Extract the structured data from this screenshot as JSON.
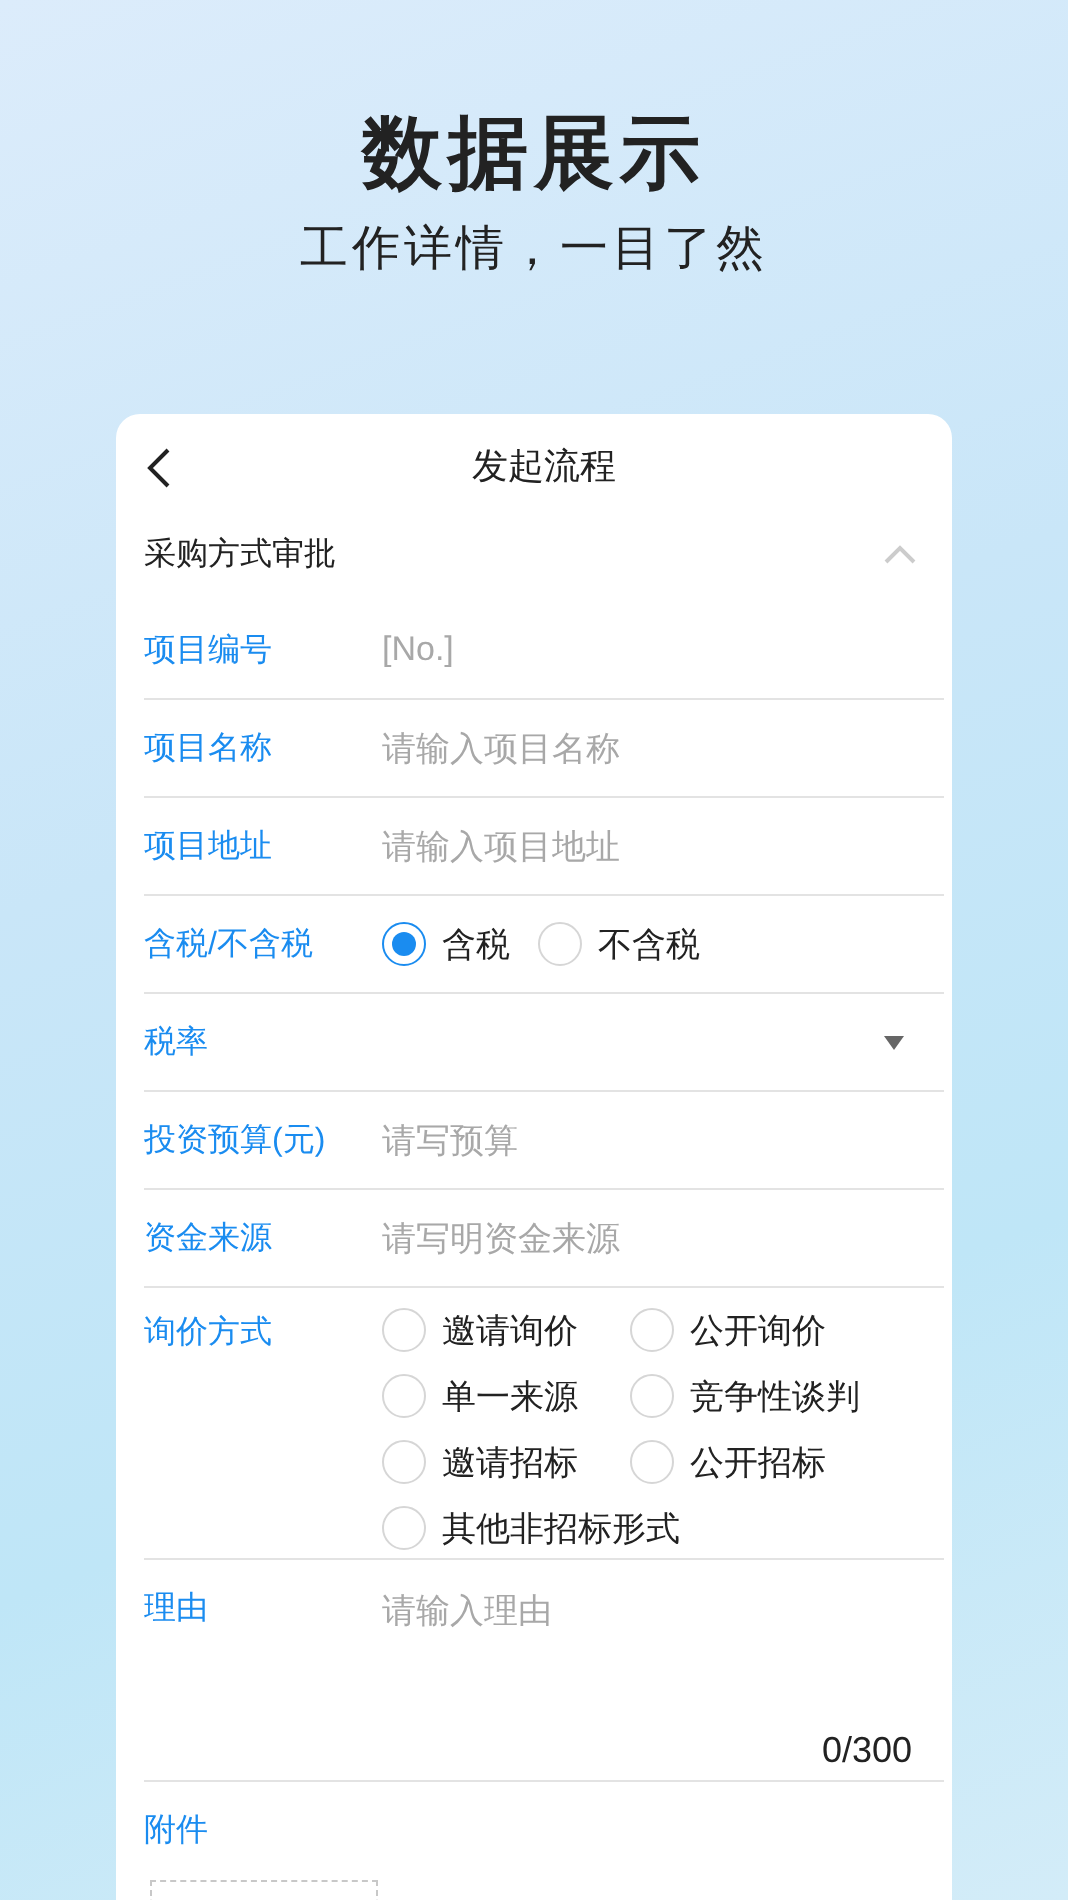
{
  "hero": {
    "title": "数据展示",
    "subtitle": "工作详情，一目了然"
  },
  "nav": {
    "title": "发起流程"
  },
  "section": {
    "title": "采购方式审批",
    "expanded": true
  },
  "fields": [
    {
      "kind": "text",
      "label": "项目编号",
      "placeholder": "[No.]"
    },
    {
      "kind": "text",
      "label": "项目名称",
      "placeholder": "请输入项目名称"
    },
    {
      "kind": "text",
      "label": "项目地址",
      "placeholder": "请输入项目地址"
    },
    {
      "kind": "radio",
      "label": "含税/不含税",
      "options": [
        {
          "label": "含税",
          "selected": true
        },
        {
          "label": "不含税",
          "selected": false
        }
      ]
    },
    {
      "kind": "select",
      "label": "税率"
    },
    {
      "kind": "text",
      "label": "投资预算(元)",
      "placeholder": "请写预算"
    },
    {
      "kind": "text",
      "label": "资金来源",
      "placeholder": "请写明资金来源"
    },
    {
      "kind": "choices",
      "label": "询价方式",
      "options": [
        {
          "label": "邀请询价",
          "selected": false
        },
        {
          "label": "公开询价",
          "selected": false
        },
        {
          "label": "单一来源",
          "selected": false
        },
        {
          "label": "竞争性谈判",
          "selected": false
        },
        {
          "label": "邀请招标",
          "selected": false
        },
        {
          "label": "公开招标",
          "selected": false
        },
        {
          "label": "其他非招标形式",
          "selected": false
        }
      ]
    },
    {
      "kind": "textarea",
      "label": "理由",
      "placeholder": "请输入理由",
      "counter": "0/300"
    },
    {
      "kind": "attachment",
      "label": "附件"
    }
  ]
}
